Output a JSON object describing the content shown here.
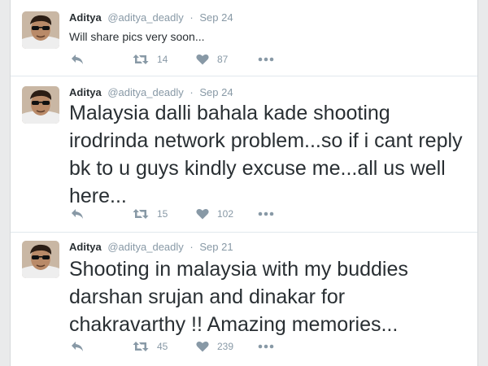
{
  "colors": {
    "action_gray": "#8899a6",
    "text": "#292f33",
    "divider": "#e1e8ed"
  },
  "icons": {
    "reply": "reply-icon",
    "retweet": "retweet-icon",
    "like": "heart-icon",
    "more": "more-icon"
  },
  "tweets": [
    {
      "name": "Aditya",
      "handle": "@aditya_deadly",
      "separator": "·",
      "date": "Sep 24",
      "text": "Will share pics very soon...",
      "retweets": "14",
      "likes": "87"
    },
    {
      "name": "Aditya",
      "handle": "@aditya_deadly",
      "separator": "·",
      "date": "Sep 24",
      "text": "Malaysia dalli bahala kade shooting irodrinda network problem...so if i cant reply bk to u guys kindly excuse me...all us well here...",
      "retweets": "15",
      "likes": "102"
    },
    {
      "name": "Aditya",
      "handle": "@aditya_deadly",
      "separator": "·",
      "date": "Sep 21",
      "text": "Shooting in malaysia with my buddies darshan srujan and dinakar for chakravarthy !! Amazing memories...",
      "retweets": "45",
      "likes": "239"
    }
  ]
}
